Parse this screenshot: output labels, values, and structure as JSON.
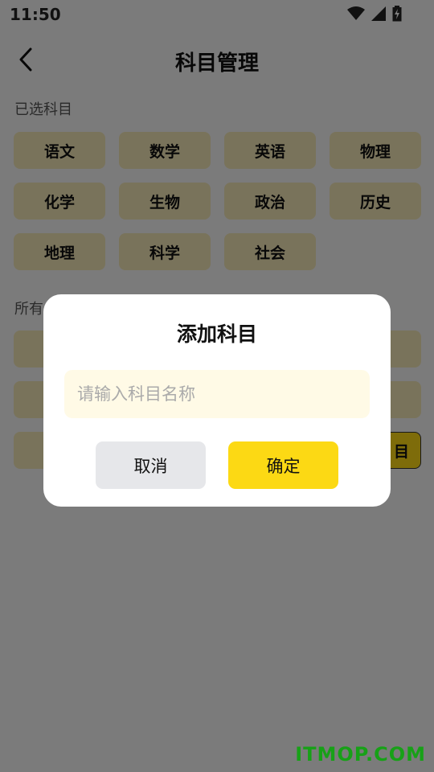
{
  "status_bar": {
    "time": "11:50"
  },
  "header": {
    "title": "科目管理"
  },
  "selected_section": {
    "label": "已选科目",
    "subjects": [
      "语文",
      "数学",
      "英语",
      "物理",
      "化学",
      "生物",
      "政治",
      "历史",
      "地理",
      "科学",
      "社会"
    ]
  },
  "all_section": {
    "label": "所有",
    "add_chip_label": "目"
  },
  "dialog": {
    "title": "添加科目",
    "input_placeholder": "请输入科目名称",
    "input_value": "",
    "cancel_label": "取消",
    "confirm_label": "确定"
  },
  "watermark": "ITMOP.COM",
  "colors": {
    "accent": "#fcd914",
    "chip_bg": "#f2e6b6",
    "input_bg": "#fffae6",
    "cancel_bg": "#e6e7ea",
    "watermark": "#17a117"
  }
}
